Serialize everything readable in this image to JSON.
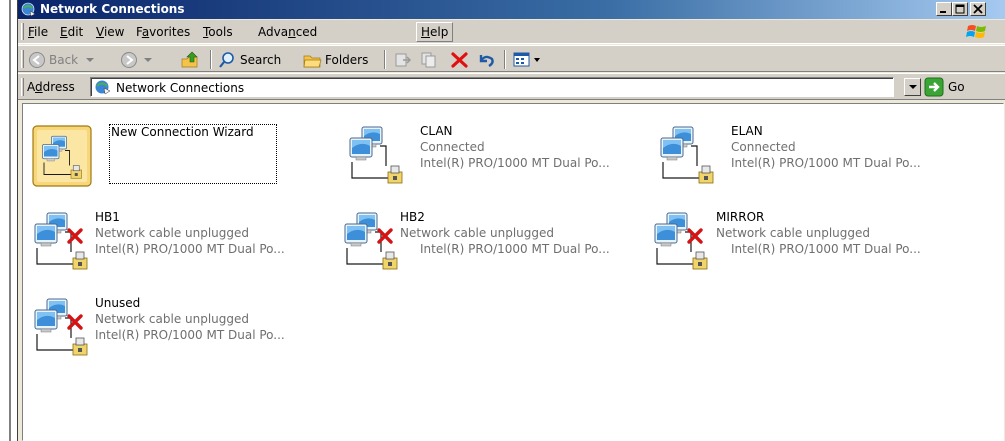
{
  "window": {
    "title": "Network Connections"
  },
  "menu": {
    "items": [
      {
        "prefix": "",
        "ul": "F",
        "rest": "ile"
      },
      {
        "prefix": "",
        "ul": "E",
        "rest": "dit"
      },
      {
        "prefix": "",
        "ul": "V",
        "rest": "iew"
      },
      {
        "prefix": "F",
        "ul": "a",
        "rest": "vorites"
      },
      {
        "prefix": "",
        "ul": "T",
        "rest": "ools"
      },
      {
        "prefix": "Adva",
        "ul": "n",
        "rest": "ced"
      },
      {
        "prefix": "",
        "ul": "H",
        "rest": "elp"
      }
    ]
  },
  "toolbar": {
    "back": "Back",
    "search": "Search",
    "folders": "Folders"
  },
  "address": {
    "label_prefix": "A",
    "label_ul": "d",
    "label_rest": "dress",
    "value": "Network Connections",
    "go": "Go"
  },
  "items": {
    "wizard": {
      "name": "New Connection Wizard"
    },
    "clan": {
      "name": "CLAN",
      "status": "Connected",
      "device": "Intel(R) PRO/1000 MT Dual Po..."
    },
    "elan": {
      "name": "ELAN",
      "status": "Connected",
      "device": "Intel(R) PRO/1000 MT Dual Po..."
    },
    "hb1": {
      "name": "HB1",
      "status": "Network cable unplugged",
      "device": "Intel(R) PRO/1000 MT Dual Po..."
    },
    "hb2": {
      "name": "HB2",
      "status": "Network cable unplugged",
      "device": "Intel(R) PRO/1000 MT Dual Po..."
    },
    "mirror": {
      "name": "MIRROR",
      "status": "Network cable unplugged",
      "device": "Intel(R) PRO/1000 MT Dual Po..."
    },
    "unused": {
      "name": "Unused",
      "status": "Network cable unplugged",
      "device": "Intel(R) PRO/1000 MT Dual Po..."
    }
  },
  "icons": {
    "network": "network-connection-icon",
    "disconnected": "red-x-icon",
    "wizard": "connection-wizard-icon"
  }
}
